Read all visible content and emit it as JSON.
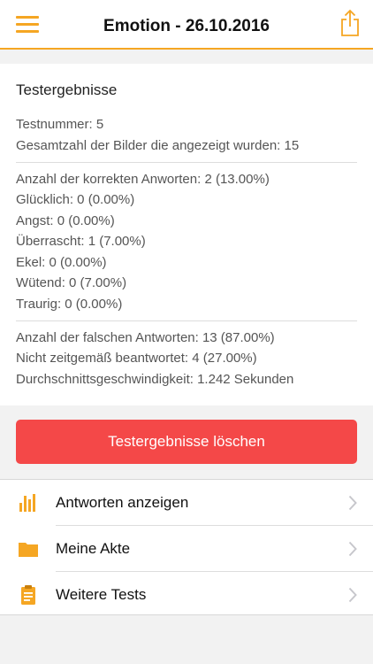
{
  "header": {
    "title": "Emotion - 26.10.2016",
    "menu_icon": "hamburger-icon",
    "share_icon": "share-icon"
  },
  "results": {
    "title": "Testergebnisse",
    "test_number": "Testnummer: 5",
    "total_images": "Gesamtzahl der Bilder die angezeigt wurden: 15",
    "correct_answers": "Anzahl der korrekten Anworten: 2 (13.00%)",
    "happy": "Glücklich: 0 (0.00%)",
    "fear": "Angst: 0 (0.00%)",
    "surprised": "Überrascht: 1 (7.00%)",
    "disgust": "Ekel: 0 (0.00%)",
    "angry": "Wütend: 0 (7.00%)",
    "sad": "Traurig: 0 (0.00%)",
    "wrong_answers": "Anzahl der falschen Antworten: 13 (87.00%)",
    "not_in_time": "Nicht zeitgemäß beantwortet: 4 (27.00%)",
    "avg_speed": "Durchschnittsgeschwindigkeit: 1.242 Sekunden"
  },
  "actions": {
    "delete_label": "Testergebnisse löschen"
  },
  "menu": {
    "items": [
      {
        "label": "Antworten anzeigen",
        "icon": "bar-chart-icon"
      },
      {
        "label": "Meine Akte",
        "icon": "folder-icon"
      },
      {
        "label": "Weitere Tests",
        "icon": "clipboard-icon"
      }
    ]
  },
  "colors": {
    "accent": "#f5a623",
    "danger": "#f44848"
  }
}
